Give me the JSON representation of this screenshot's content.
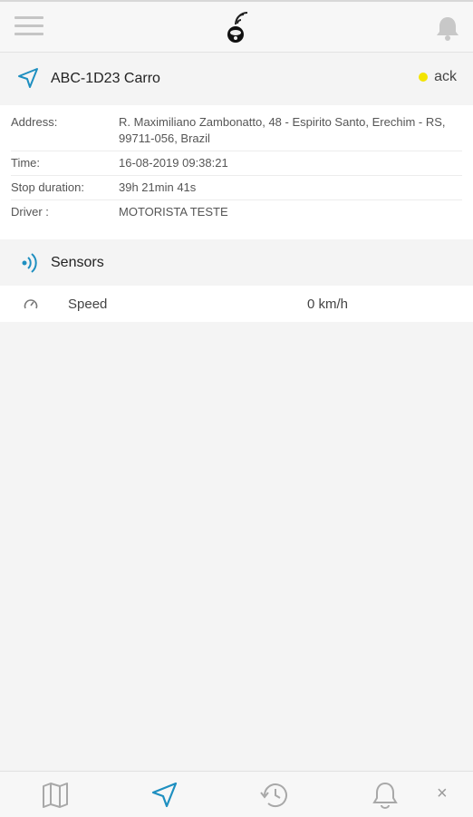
{
  "vehicle": {
    "title": "ABC-1D23 Carro",
    "status": "ack",
    "status_color": "#f3e400"
  },
  "details": [
    {
      "label": "Address:",
      "value": "R. Maximiliano Zambonatto, 48 - Espirito Santo, Erechim - RS, 99711-056, Brazil"
    },
    {
      "label": "Time:",
      "value": "16-08-2019 09:38:21"
    },
    {
      "label": "Stop duration:",
      "value": "39h 21min 41s"
    },
    {
      "label": "Driver :",
      "value": "MOTORISTA TESTE"
    }
  ],
  "sensors": {
    "title": "Sensors",
    "items": [
      {
        "name": "Speed",
        "value": "0 km/h",
        "icon": "gauge-icon"
      }
    ]
  },
  "bottom_nav": {
    "tabs": [
      "map-icon",
      "navigation-icon",
      "history-icon",
      "bell-icon"
    ],
    "active_color": "#1e8fc0",
    "inactive_color": "#a8a8a8",
    "close_glyph": "×"
  }
}
